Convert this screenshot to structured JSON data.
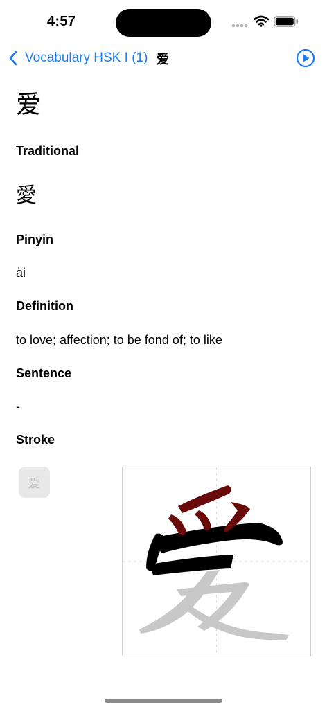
{
  "status_bar": {
    "time": "4:57"
  },
  "nav": {
    "back_label": "Vocabulary HSK I (1)",
    "title": "爱",
    "accent_color": "#1a7cf5",
    "icons": {
      "back": "chevron-left-icon",
      "play": "play-circle-icon"
    }
  },
  "word": {
    "simplified": "爱",
    "traditional_label": "Traditional",
    "traditional": "愛",
    "pinyin_label": "Pinyin",
    "pinyin": "ài",
    "definition_label": "Definition",
    "definition": "to love; affection; to be fond of; to like",
    "sentence_label": "Sentence",
    "sentence": "-",
    "stroke_label": "Stroke"
  },
  "stroke": {
    "thumbnail_char": "爱",
    "colors": {
      "completed": "#000000",
      "current": "#6a0b0b",
      "pending": "#c8c8c8",
      "guide": "#dddddd"
    }
  }
}
